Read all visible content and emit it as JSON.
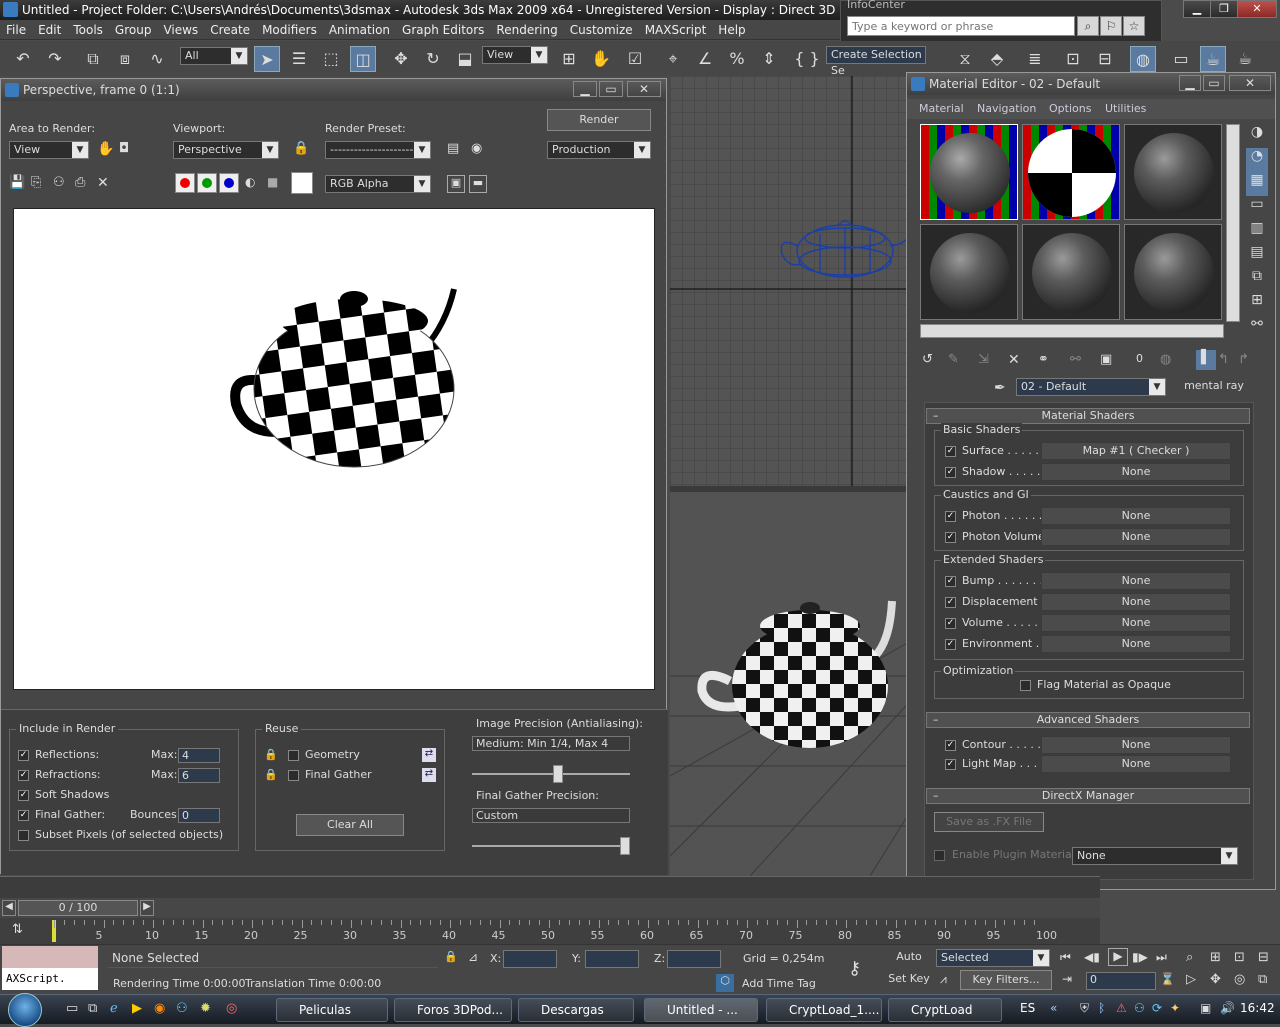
{
  "app": {
    "title": "Untitled   - Project Folder: C:\\Users\\Andrés\\Documents\\3dsmax   - Autodesk 3ds Max  2009 x64  - Unregistered Version    - Display : Direct 3D"
  },
  "infocenter": {
    "label": "InfoCenter",
    "placeholder": "Type a keyword or phrase"
  },
  "menu": [
    "File",
    "Edit",
    "Tools",
    "Group",
    "Views",
    "Create",
    "Modifiers",
    "Animation",
    "Graph Editors",
    "Rendering",
    "Customize",
    "MAXScript",
    "Help"
  ],
  "toolbar": {
    "filter": "All",
    "ref_coord": "View",
    "named_selection": "Create Selection Se"
  },
  "render_frame": {
    "title": "Perspective, frame 0 (1:1)",
    "area_label": "Area to Render:",
    "area_value": "View",
    "viewport_label": "Viewport:",
    "viewport_value": "Perspective",
    "preset_label": "Render Preset:",
    "preset_value": "-------------------------",
    "render_button": "Render",
    "production": "Production",
    "channel": "RGB Alpha",
    "include_title": "Include in Render",
    "reflections": "Reflections:",
    "refractions": "Refractions:",
    "soft_shadows": "Soft Shadows",
    "final_gather": "Final Gather:",
    "subset": "Subset Pixels (of selected objects)",
    "max_label": "Max:",
    "reflections_max": "4",
    "refractions_max": "6",
    "bounces_label": "Bounces:",
    "bounces": "0",
    "reuse_title": "Reuse",
    "geometry": "Geometry",
    "final_gather_reuse": "Final Gather",
    "clear_all": "Clear All",
    "precision_label": "Image Precision (Antialiasing):",
    "precision_value": "Medium: Min 1/4, Max 4",
    "precision_level": 0.55,
    "fg_precision_label": "Final Gather Precision:",
    "fg_precision_value": "Custom",
    "fg_precision_level": 1.0
  },
  "material_editor": {
    "title": "Material Editor - 02 - Default",
    "menu": [
      "Material",
      "Navigation",
      "Options",
      "Utilities"
    ],
    "material_name": "02 - Default",
    "material_type": "mental ray",
    "rollout_material_shaders": "Material Shaders",
    "basic_shaders": "Basic Shaders",
    "surface": "Surface . . . . . .",
    "surface_map": "Map #1  ( Checker )",
    "shadow": "Shadow . . . . . .",
    "none": "None",
    "caustics_gi": "Caustics and GI",
    "photon": "Photon . . . . . . .",
    "photon_volume": "Photon Volume .",
    "extended_shaders": "Extended Shaders",
    "bump": "Bump . . . . . . . .",
    "displacement": "Displacement . .",
    "volume": "Volume . . . . . . .",
    "environment": "Environment . . .",
    "optimization": "Optimization",
    "flag_opaque": "Flag Material as Opaque",
    "rollout_advanced": "Advanced Shaders",
    "contour": "Contour . . . . . .",
    "light_map": "Light Map . . . . .",
    "rollout_directx": "DirectX Manager",
    "save_fx": "Save as .FX File",
    "enable_plugin": "Enable Plugin Material",
    "plugin_value": "None",
    "sample_slot_count": "0"
  },
  "timeline": {
    "frame": "0 / 100",
    "ticks": [
      "0",
      "5",
      "10",
      "15",
      "20",
      "25",
      "30",
      "35",
      "40",
      "45",
      "50",
      "55",
      "60",
      "65",
      "70",
      "75",
      "80",
      "85",
      "90",
      "95",
      "100"
    ]
  },
  "status": {
    "selection": "None Selected",
    "maxscript": "AXScript.",
    "rendering_time": "Rendering Time  0:00:00",
    "translation_time": "Translation Time  0:00:00",
    "x_label": "X:",
    "y_label": "Y:",
    "z_label": "Z:",
    "grid": "Grid = 0,254m",
    "add_time_tag": "Add Time Tag",
    "auto_key": "Auto Key",
    "set_key": "Set Key",
    "selected": "Selected",
    "key_filters": "Key Filters...",
    "current_frame": "0"
  },
  "taskbar": {
    "items": [
      "Peliculas",
      "Foros 3DPod...",
      "Descargas",
      "Untitled    - ...",
      "CryptLoad_1....",
      "CryptLoad"
    ],
    "lang": "ES",
    "clock": "16:42"
  }
}
